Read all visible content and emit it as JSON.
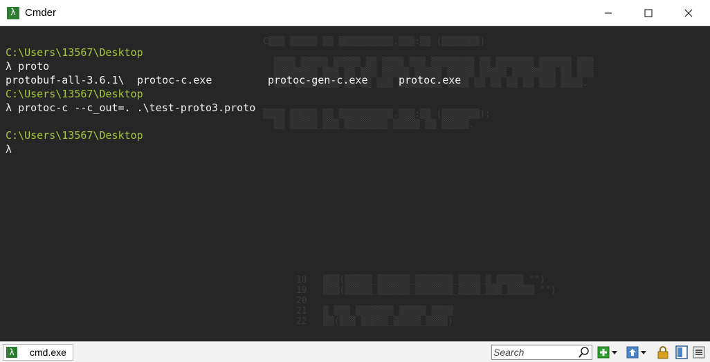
{
  "window": {
    "title": "Cmder",
    "icon": "lambda-icon"
  },
  "terminal": {
    "lines": [
      {
        "path": "C:\\Users\\13567\\Desktop"
      },
      {
        "prompt": "λ",
        "command": "proto"
      },
      {
        "ls": [
          "protobuf-all-3.6.1\\",
          "protoc-c.exe",
          "protoc-gen-c.exe",
          "protoc.exe"
        ]
      },
      {
        "path": "C:\\Users\\13567\\Desktop"
      },
      {
        "prompt": "λ",
        "command": "protoc-c --c_out=. .\\test-proto3.proto"
      },
      {
        "path": "C:\\Users\\13567\\Desktop"
      },
      {
        "prompt": "λ"
      }
    ],
    "colors": {
      "background": "#262626",
      "path": "#a4c639",
      "text": "#f0f0f0"
    }
  },
  "taskbar": {
    "tab_label": "cmd.exe",
    "search_placeholder": "Search",
    "icons": [
      "search-icon",
      "add-icon",
      "dropdown-icon",
      "upload-icon",
      "dropdown-icon",
      "lock-icon",
      "split-view-icon",
      "menu-icon"
    ],
    "colors": {
      "add": "#2e9e2e",
      "upload": "#4a86c8",
      "lock": "#d8a020"
    }
  }
}
